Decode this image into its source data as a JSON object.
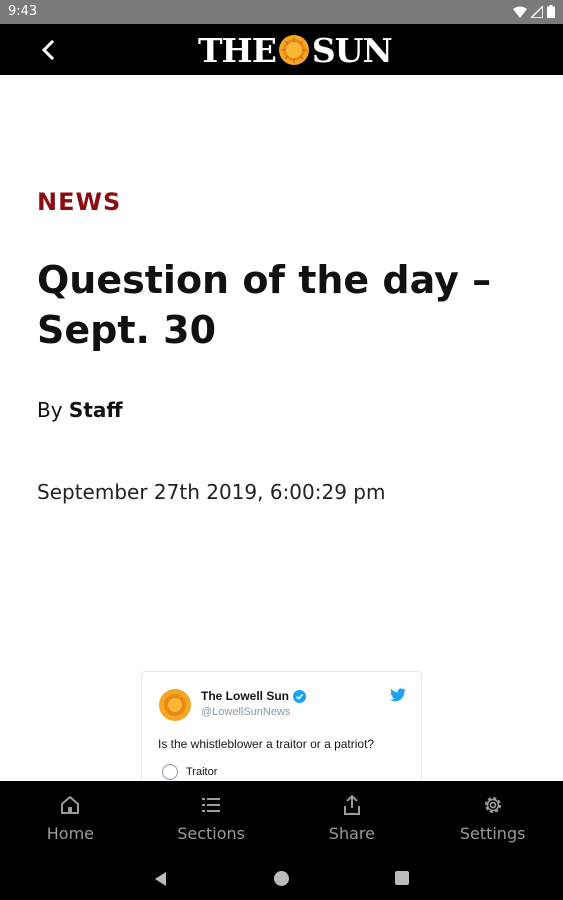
{
  "status_bar": {
    "time": "9:43"
  },
  "app_bar": {
    "masthead_left": "THE",
    "masthead_right": "SUN"
  },
  "article": {
    "category": "NEWS",
    "headline_line1": "Question of the day –",
    "headline_line2": "Sept. 30",
    "byline_prefix": "By",
    "author": "Staff",
    "date": "September 27th 2019, 6:00:29 pm"
  },
  "tweet": {
    "name": "The Lowell Sun",
    "handle": "@LowellSunNews",
    "text": "Is the whistleblower a traitor or a patriot?",
    "poll_options": [
      "Traitor"
    ]
  },
  "bottom_nav": {
    "items": [
      {
        "label": "Home",
        "icon": "home-icon"
      },
      {
        "label": "Sections",
        "icon": "list-icon"
      },
      {
        "label": "Share",
        "icon": "share-icon"
      },
      {
        "label": "Settings",
        "icon": "gear-icon"
      }
    ]
  },
  "colors": {
    "category_red": "#8b0d12",
    "app_bar": "#000000",
    "nav_inactive": "#9b9b9b",
    "sun_orange": "#f5a623"
  }
}
